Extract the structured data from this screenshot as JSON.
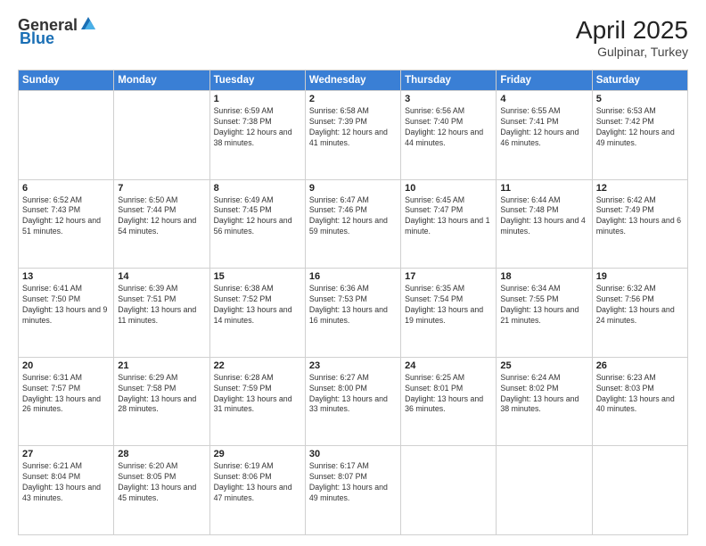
{
  "header": {
    "logo_general": "General",
    "logo_blue": "Blue",
    "title": "April 2025",
    "location": "Gulpinar, Turkey"
  },
  "weekdays": [
    "Sunday",
    "Monday",
    "Tuesday",
    "Wednesday",
    "Thursday",
    "Friday",
    "Saturday"
  ],
  "weeks": [
    [
      {
        "day": "",
        "info": ""
      },
      {
        "day": "",
        "info": ""
      },
      {
        "day": "1",
        "info": "Sunrise: 6:59 AM\nSunset: 7:38 PM\nDaylight: 12 hours and 38 minutes."
      },
      {
        "day": "2",
        "info": "Sunrise: 6:58 AM\nSunset: 7:39 PM\nDaylight: 12 hours and 41 minutes."
      },
      {
        "day": "3",
        "info": "Sunrise: 6:56 AM\nSunset: 7:40 PM\nDaylight: 12 hours and 44 minutes."
      },
      {
        "day": "4",
        "info": "Sunrise: 6:55 AM\nSunset: 7:41 PM\nDaylight: 12 hours and 46 minutes."
      },
      {
        "day": "5",
        "info": "Sunrise: 6:53 AM\nSunset: 7:42 PM\nDaylight: 12 hours and 49 minutes."
      }
    ],
    [
      {
        "day": "6",
        "info": "Sunrise: 6:52 AM\nSunset: 7:43 PM\nDaylight: 12 hours and 51 minutes."
      },
      {
        "day": "7",
        "info": "Sunrise: 6:50 AM\nSunset: 7:44 PM\nDaylight: 12 hours and 54 minutes."
      },
      {
        "day": "8",
        "info": "Sunrise: 6:49 AM\nSunset: 7:45 PM\nDaylight: 12 hours and 56 minutes."
      },
      {
        "day": "9",
        "info": "Sunrise: 6:47 AM\nSunset: 7:46 PM\nDaylight: 12 hours and 59 minutes."
      },
      {
        "day": "10",
        "info": "Sunrise: 6:45 AM\nSunset: 7:47 PM\nDaylight: 13 hours and 1 minute."
      },
      {
        "day": "11",
        "info": "Sunrise: 6:44 AM\nSunset: 7:48 PM\nDaylight: 13 hours and 4 minutes."
      },
      {
        "day": "12",
        "info": "Sunrise: 6:42 AM\nSunset: 7:49 PM\nDaylight: 13 hours and 6 minutes."
      }
    ],
    [
      {
        "day": "13",
        "info": "Sunrise: 6:41 AM\nSunset: 7:50 PM\nDaylight: 13 hours and 9 minutes."
      },
      {
        "day": "14",
        "info": "Sunrise: 6:39 AM\nSunset: 7:51 PM\nDaylight: 13 hours and 11 minutes."
      },
      {
        "day": "15",
        "info": "Sunrise: 6:38 AM\nSunset: 7:52 PM\nDaylight: 13 hours and 14 minutes."
      },
      {
        "day": "16",
        "info": "Sunrise: 6:36 AM\nSunset: 7:53 PM\nDaylight: 13 hours and 16 minutes."
      },
      {
        "day": "17",
        "info": "Sunrise: 6:35 AM\nSunset: 7:54 PM\nDaylight: 13 hours and 19 minutes."
      },
      {
        "day": "18",
        "info": "Sunrise: 6:34 AM\nSunset: 7:55 PM\nDaylight: 13 hours and 21 minutes."
      },
      {
        "day": "19",
        "info": "Sunrise: 6:32 AM\nSunset: 7:56 PM\nDaylight: 13 hours and 24 minutes."
      }
    ],
    [
      {
        "day": "20",
        "info": "Sunrise: 6:31 AM\nSunset: 7:57 PM\nDaylight: 13 hours and 26 minutes."
      },
      {
        "day": "21",
        "info": "Sunrise: 6:29 AM\nSunset: 7:58 PM\nDaylight: 13 hours and 28 minutes."
      },
      {
        "day": "22",
        "info": "Sunrise: 6:28 AM\nSunset: 7:59 PM\nDaylight: 13 hours and 31 minutes."
      },
      {
        "day": "23",
        "info": "Sunrise: 6:27 AM\nSunset: 8:00 PM\nDaylight: 13 hours and 33 minutes."
      },
      {
        "day": "24",
        "info": "Sunrise: 6:25 AM\nSunset: 8:01 PM\nDaylight: 13 hours and 36 minutes."
      },
      {
        "day": "25",
        "info": "Sunrise: 6:24 AM\nSunset: 8:02 PM\nDaylight: 13 hours and 38 minutes."
      },
      {
        "day": "26",
        "info": "Sunrise: 6:23 AM\nSunset: 8:03 PM\nDaylight: 13 hours and 40 minutes."
      }
    ],
    [
      {
        "day": "27",
        "info": "Sunrise: 6:21 AM\nSunset: 8:04 PM\nDaylight: 13 hours and 43 minutes."
      },
      {
        "day": "28",
        "info": "Sunrise: 6:20 AM\nSunset: 8:05 PM\nDaylight: 13 hours and 45 minutes."
      },
      {
        "day": "29",
        "info": "Sunrise: 6:19 AM\nSunset: 8:06 PM\nDaylight: 13 hours and 47 minutes."
      },
      {
        "day": "30",
        "info": "Sunrise: 6:17 AM\nSunset: 8:07 PM\nDaylight: 13 hours and 49 minutes."
      },
      {
        "day": "",
        "info": ""
      },
      {
        "day": "",
        "info": ""
      },
      {
        "day": "",
        "info": ""
      }
    ]
  ]
}
